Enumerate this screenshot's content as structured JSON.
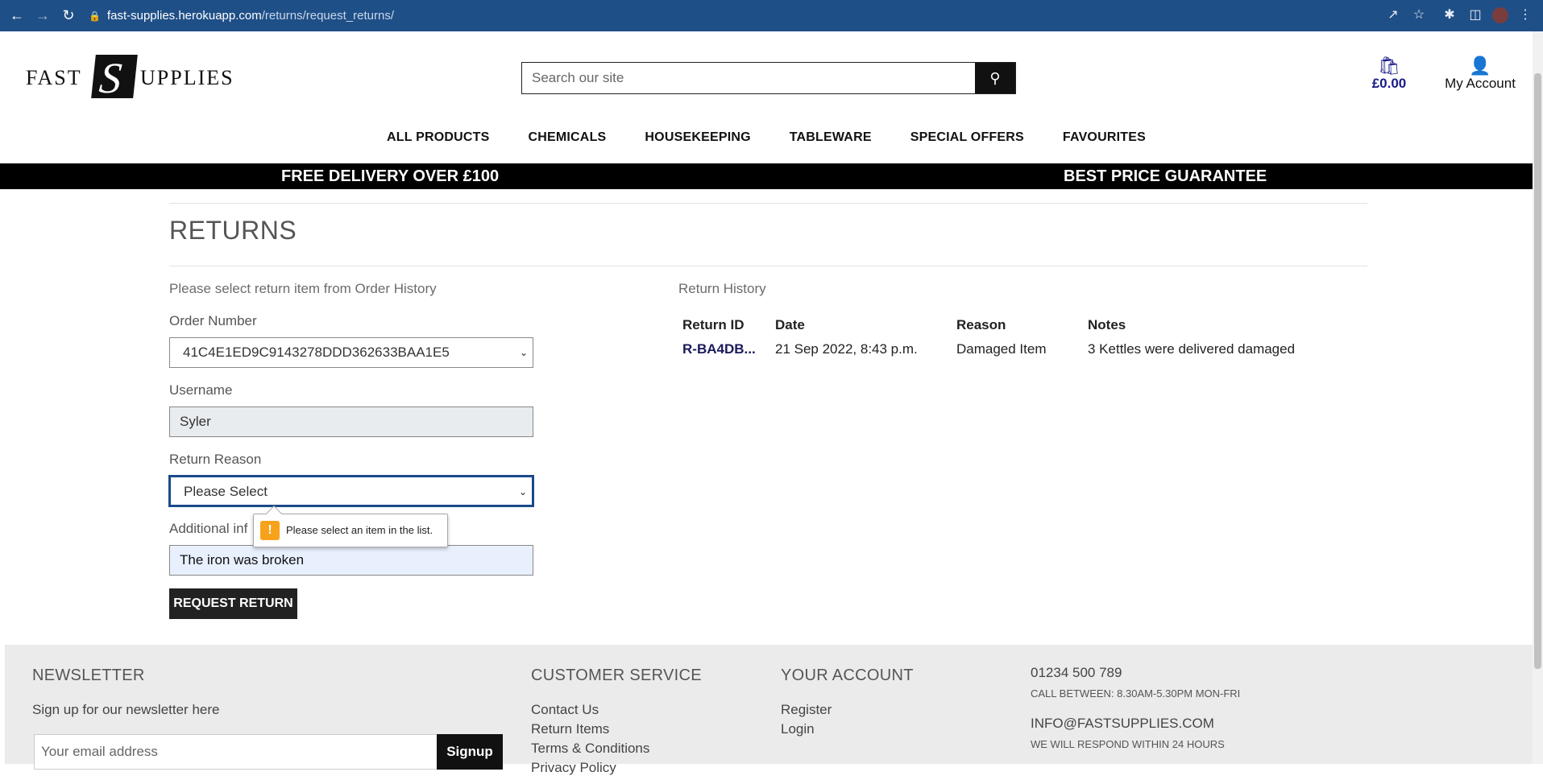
{
  "browser": {
    "url_host": "fast-supplies.herokuapp.com",
    "url_path": "/returns/request_returns/"
  },
  "header": {
    "logo": {
      "part1": "FAST",
      "part2": "S",
      "part3": "UPPLIES"
    },
    "search_placeholder": "Search our site",
    "basket_amount": "£0.00",
    "account_label": "My Account"
  },
  "nav": {
    "items": [
      "ALL PRODUCTS",
      "CHEMICALS",
      "HOUSEKEEPING",
      "TABLEWARE",
      "SPECIAL OFFERS",
      "FAVOURITES"
    ]
  },
  "promo": {
    "left": "FREE DELIVERY OVER £100",
    "right": "BEST PRICE GUARANTEE"
  },
  "page": {
    "title": "RETURNS",
    "instruction": "Please select return item from Order History"
  },
  "form": {
    "order_label": "Order Number",
    "order_value": "41C4E1ED9C9143278DDD362633BAA1E5",
    "username_label": "Username",
    "username_value": "Syler",
    "reason_label": "Return Reason",
    "reason_value": "Please Select",
    "info_label": "Additional information",
    "info_label_visible": "Additional inf",
    "info_value": "The iron was broken",
    "submit_label": "REQUEST RETURN",
    "validation_message": "Please select an item in the list."
  },
  "history": {
    "title": "Return History",
    "columns": [
      "Return ID",
      "Date",
      "Reason",
      "Notes"
    ],
    "rows": [
      {
        "id": "R-BA4DB...",
        "date": "21 Sep 2022, 8:43 p.m.",
        "reason": "Damaged Item",
        "notes": "3 Kettles were delivered damaged"
      }
    ]
  },
  "footer": {
    "newsletter_heading": "NEWSLETTER",
    "newsletter_text": "Sign up for our newsletter here",
    "email_placeholder": "Your email address",
    "signup_label": "Signup",
    "customer_service_heading": "CUSTOMER SERVICE",
    "customer_service_links": [
      "Contact Us",
      "Return Items",
      "Terms & Conditions",
      "Privacy Policy"
    ],
    "account_heading": "YOUR ACCOUNT",
    "account_links": [
      "Register",
      "Login"
    ],
    "phone": "01234 500 789",
    "phone_hours": "CALL BETWEEN: 8.30AM-5.30PM MON-FRI",
    "email": "INFO@FASTSUPPLIES.COM",
    "email_note": "WE WILL RESPOND WITHIN 24 HOURS"
  },
  "colors": {
    "chrome": "#1f4f87",
    "basket": "#1a1a8a",
    "promo_bg": "#000000",
    "warning": "#f7a21b"
  }
}
